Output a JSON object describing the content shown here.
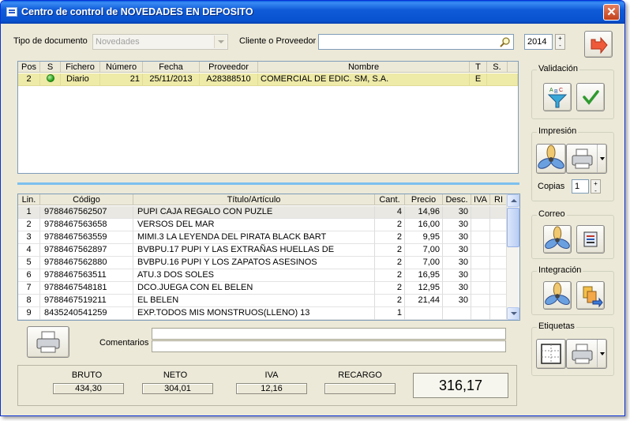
{
  "window": {
    "title": "Centro de control de NOVEDADES EN DEPOSITO",
    "close_glyph": "✕"
  },
  "filters": {
    "tipo_label": "Tipo de documento",
    "tipo_value": "Novedades",
    "cliente_label": "Cliente o Proveedor",
    "cliente_value": "",
    "year": "2014",
    "spin_up": "+",
    "spin_down": "-"
  },
  "docs": {
    "headers": [
      "Pos",
      "S",
      "Fichero",
      "Número",
      "Fecha",
      "Proveedor",
      "Nombre",
      "T",
      "S."
    ],
    "rows": [
      {
        "pos": "2",
        "status_color": "#1f9a10",
        "fichero": "Diario",
        "numero": "21",
        "fecha": "25/11/2013",
        "proveedor": "A28388510",
        "nombre": "COMERCIAL DE EDIC. SM, S.A.",
        "t": "E",
        "s": ""
      }
    ]
  },
  "items": {
    "headers": [
      "Lin.",
      "Código",
      "Título/Artículo",
      "Cant.",
      "Precio",
      "Desc.",
      "IVA",
      "RI"
    ],
    "rows": [
      {
        "lin": "1",
        "codigo": "9788467562507",
        "titulo": "PUPI CAJA REGALO CON PUZLE",
        "cant": "4",
        "precio": "14,96",
        "desc": "30",
        "iva": "",
        "ri": ""
      },
      {
        "lin": "2",
        "codigo": "9788467563658",
        "titulo": "VERSOS DEL MAR",
        "cant": "2",
        "precio": "16,00",
        "desc": "30",
        "iva": "",
        "ri": ""
      },
      {
        "lin": "3",
        "codigo": "9788467563559",
        "titulo": "MIMI.3 LA LEYENDA DEL PIRATA BLACK BART",
        "cant": "2",
        "precio": "9,95",
        "desc": "30",
        "iva": "",
        "ri": ""
      },
      {
        "lin": "4",
        "codigo": "9788467562897",
        "titulo": "BVBPU.17 PUPI Y LAS EXTRAÑAS HUELLAS DE",
        "cant": "2",
        "precio": "7,00",
        "desc": "30",
        "iva": "",
        "ri": ""
      },
      {
        "lin": "5",
        "codigo": "9788467562880",
        "titulo": "BVBPU.16  PUPI Y LOS ZAPATOS ASESINOS",
        "cant": "2",
        "precio": "7,00",
        "desc": "30",
        "iva": "",
        "ri": ""
      },
      {
        "lin": "6",
        "codigo": "9788467563511",
        "titulo": "ATU.3 DOS SOLES",
        "cant": "2",
        "precio": "16,95",
        "desc": "30",
        "iva": "",
        "ri": ""
      },
      {
        "lin": "7",
        "codigo": "9788467548181",
        "titulo": "DCO.JUEGA CON EL BELEN",
        "cant": "2",
        "precio": "12,95",
        "desc": "30",
        "iva": "",
        "ri": ""
      },
      {
        "lin": "8",
        "codigo": "9788467519211",
        "titulo": "EL BELEN",
        "cant": "2",
        "precio": "21,44",
        "desc": "30",
        "iva": "",
        "ri": ""
      },
      {
        "lin": "9",
        "codigo": "8435240541259",
        "titulo": "EXP.TODOS MIS MONSTRUOS(LLENO) 13",
        "cant": "1",
        "precio": "",
        "desc": "",
        "iva": "",
        "ri": ""
      }
    ]
  },
  "comentarios_label": "Comentarios",
  "totals": {
    "bruto_label": "BRUTO",
    "bruto": "434,30",
    "neto_label": "NETO",
    "neto": "304,01",
    "iva_label": "IVA",
    "iva": "12,16",
    "recargo_label": "RECARGO",
    "recargo": "",
    "total": "316,17"
  },
  "side": {
    "validacion": "Validación",
    "impresion": "Impresión",
    "copias_label": "Copias",
    "copias": "1",
    "correo": "Correo",
    "integracion": "Integración",
    "etiquetas": "Etiquetas"
  },
  "colors": {
    "selected_row": "#eeeaa8",
    "titlebar": "#0852cf",
    "accent": "#7cc0ee"
  },
  "icons": [
    "app-icon",
    "close-icon",
    "search-icon",
    "exit-arrow-icon",
    "funnel-abc-icon",
    "checkmark-icon",
    "propeller-icon",
    "printer-icon",
    "email-export-icon",
    "integration-icon",
    "label-sheet-icon"
  ]
}
